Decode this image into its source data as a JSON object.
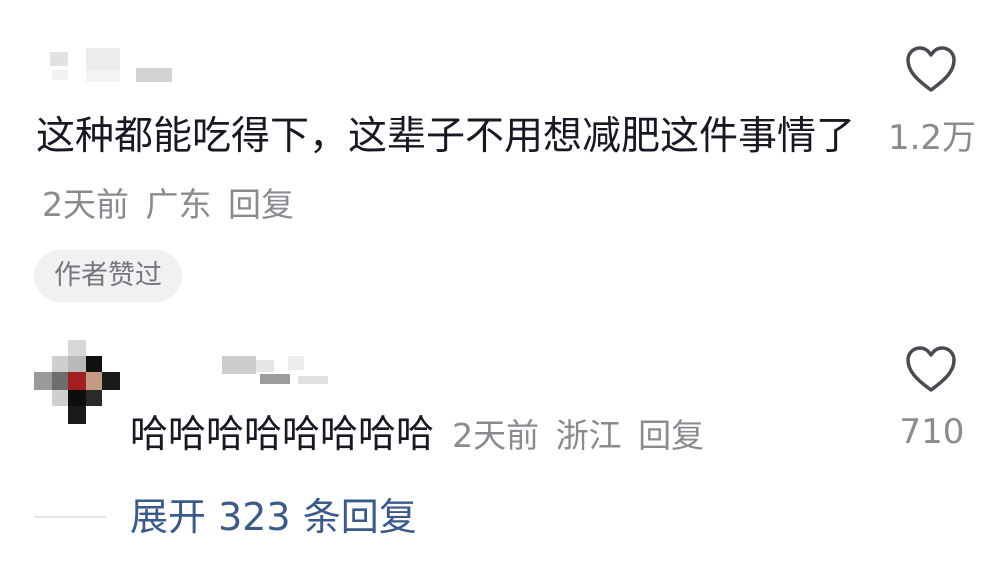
{
  "comments": [
    {
      "text": "这种都能吃得下，这辈子不用想减肥这件事情了",
      "time": "2天前",
      "location": "广东",
      "reply_label": "回复",
      "likes": "1.2万",
      "author_liked_badge": "作者赞过"
    },
    {
      "text": "哈哈哈哈哈哈哈哈",
      "time": "2天前",
      "location": "浙江",
      "reply_label": "回复",
      "likes": "710"
    }
  ],
  "expand_replies_label": "展开 323 条回复",
  "icons": {
    "like": "heart-outline-icon"
  },
  "colors": {
    "primary_text": "#161823",
    "meta_text": "#8a8b91",
    "link_blue": "#3b5a8c",
    "badge_bg": "#f1f1f2"
  }
}
